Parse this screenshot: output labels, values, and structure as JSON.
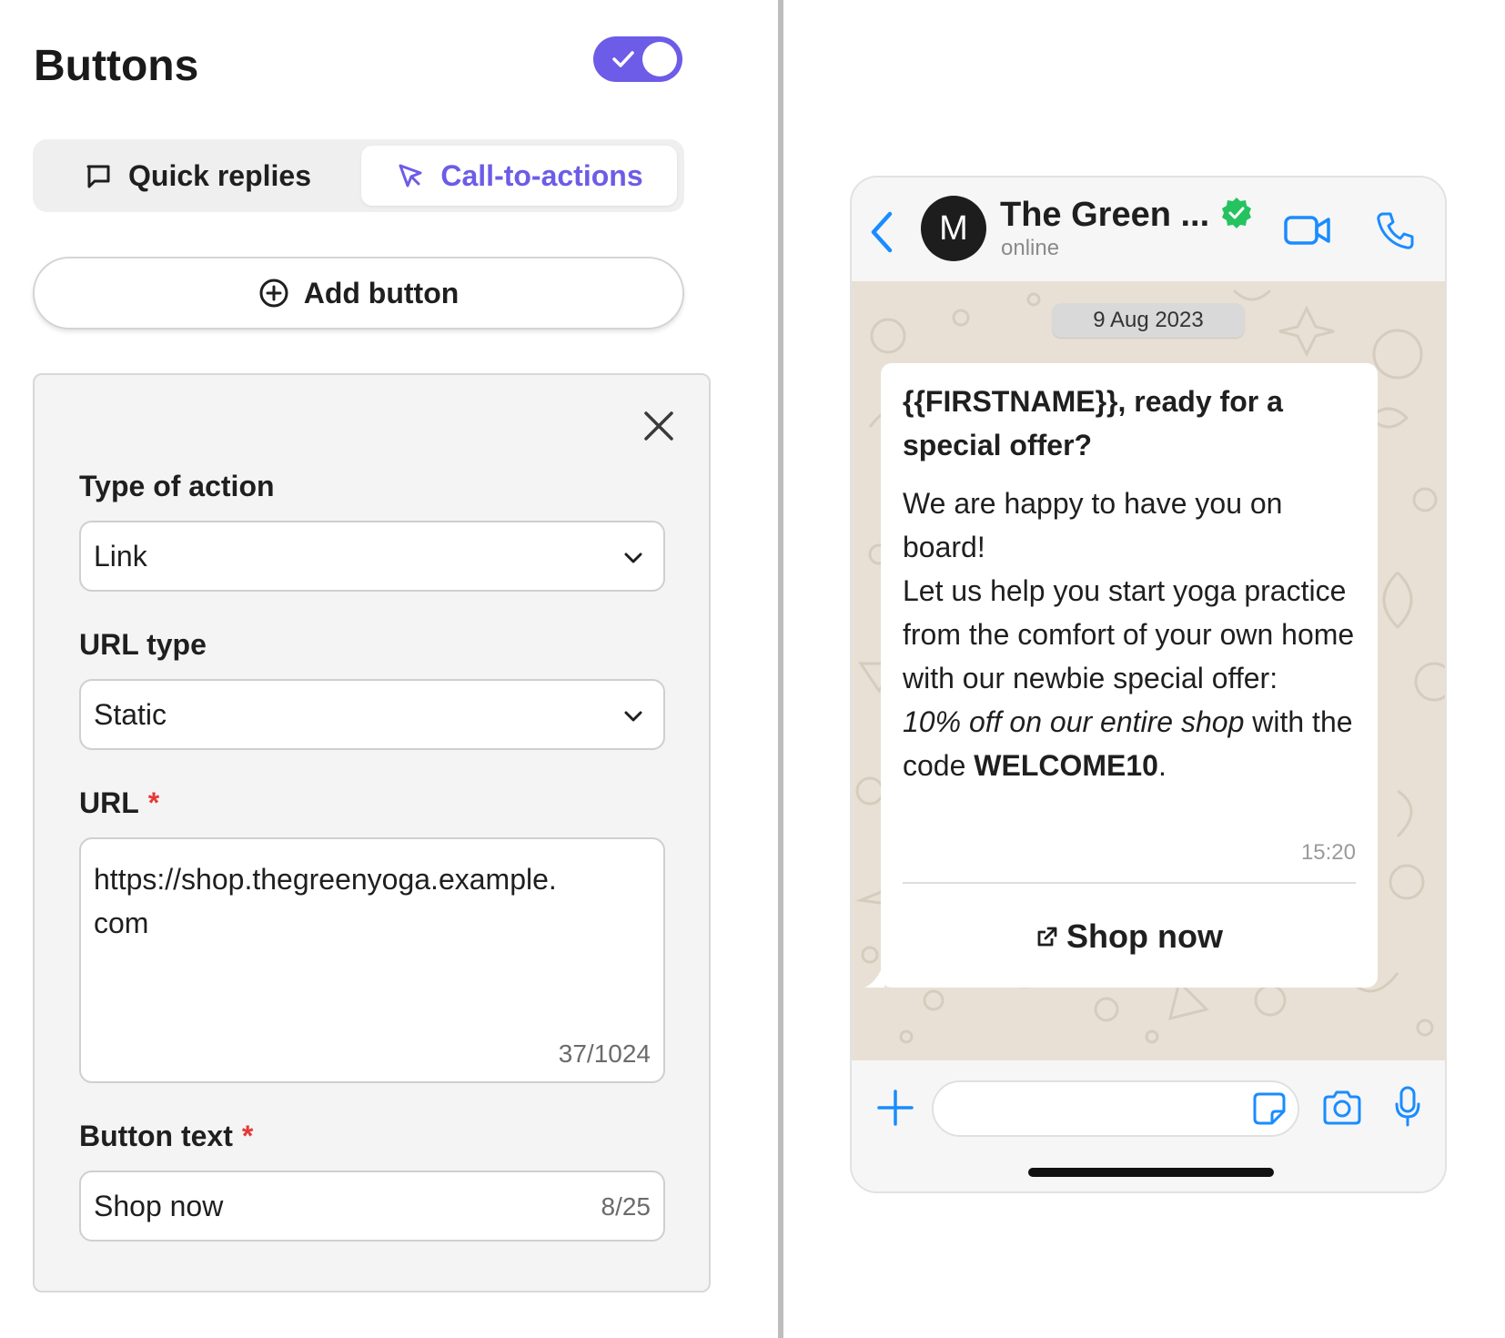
{
  "editor": {
    "title": "Buttons",
    "toggle_on": true,
    "tabs": [
      {
        "label": "Quick replies",
        "icon": "chat-bubble-icon",
        "active": false
      },
      {
        "label": "Call-to-actions",
        "icon": "cursor-click-icon",
        "active": true
      }
    ],
    "add_button_label": "Add button",
    "button_config": {
      "type_of_action_label": "Type of action",
      "type_of_action_value": "Link",
      "url_type_label": "URL type",
      "url_type_value": "Static",
      "url_label": "URL",
      "url_required_mark": "*",
      "url_value": "https://shop.thegreenyoga.example.com",
      "url_counter": "37/1024",
      "button_text_label": "Button text",
      "button_text_required_mark": "*",
      "button_text_value": "Shop now",
      "button_text_counter": "8/25"
    }
  },
  "preview": {
    "contact": {
      "avatar_letter": "M",
      "name": "The Green ...",
      "status": "online",
      "verified": true
    },
    "date": "9 Aug 2023",
    "message": {
      "title": "{{FIRSTNAME}}, ready for a special offer?",
      "body_line1": "We are happy to have you on board!",
      "body_line2": "Let us help you start yoga practice from the comfort of your own home with our newbie special offer:",
      "body_italic": "10% off on our entire shop",
      "body_with": " with the code ",
      "body_code": "WELCOME10",
      "body_end": ".",
      "time": "15:20",
      "cta_label": "Shop now"
    }
  },
  "colors": {
    "accent": "#6c5ce7",
    "whatsapp_blue": "#1a8cff",
    "verified_green": "#25c360",
    "chat_background": "#e8e0d4",
    "required": "#e53935"
  }
}
